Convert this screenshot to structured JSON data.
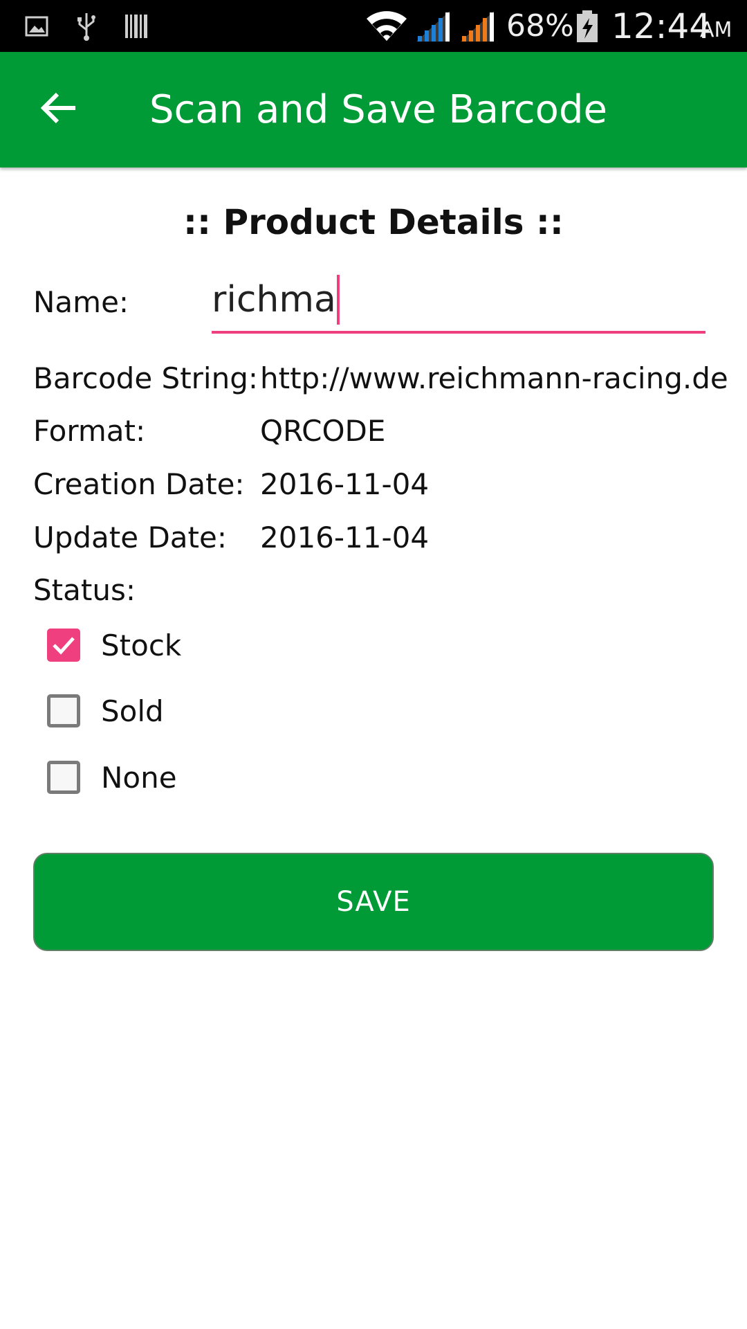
{
  "status_bar": {
    "icons": [
      "image-icon",
      "usb-icon",
      "barcode-icon",
      "wifi-icon",
      "signal-icon",
      "signal-icon",
      "battery-charging-icon"
    ],
    "battery_text": "68%",
    "time": "12:44",
    "ampm": "AM",
    "signal_colors": [
      "#1e7fd6",
      "#ef7a1a"
    ]
  },
  "app_bar": {
    "title": "Scan and Save Barcode",
    "color": "#009a37"
  },
  "section": {
    "title": ":: Product Details ::"
  },
  "form": {
    "name_label": "Name:",
    "name_value": "richma",
    "barcode_label": "Barcode String:",
    "barcode_value": "http://www.reichmann-racing.de",
    "format_label": "Format:",
    "format_value": "QRCODE",
    "creation_label": "Creation Date:",
    "creation_value": "2016-11-04",
    "update_label": "Update Date:",
    "update_value": "2016-11-04",
    "status_label": "Status:",
    "status_options": [
      {
        "label": "Stock",
        "checked": true
      },
      {
        "label": "Sold",
        "checked": false
      },
      {
        "label": "None",
        "checked": false
      }
    ],
    "accent_color": "#ef3f7f"
  },
  "save_button": {
    "label": "SAVE"
  }
}
